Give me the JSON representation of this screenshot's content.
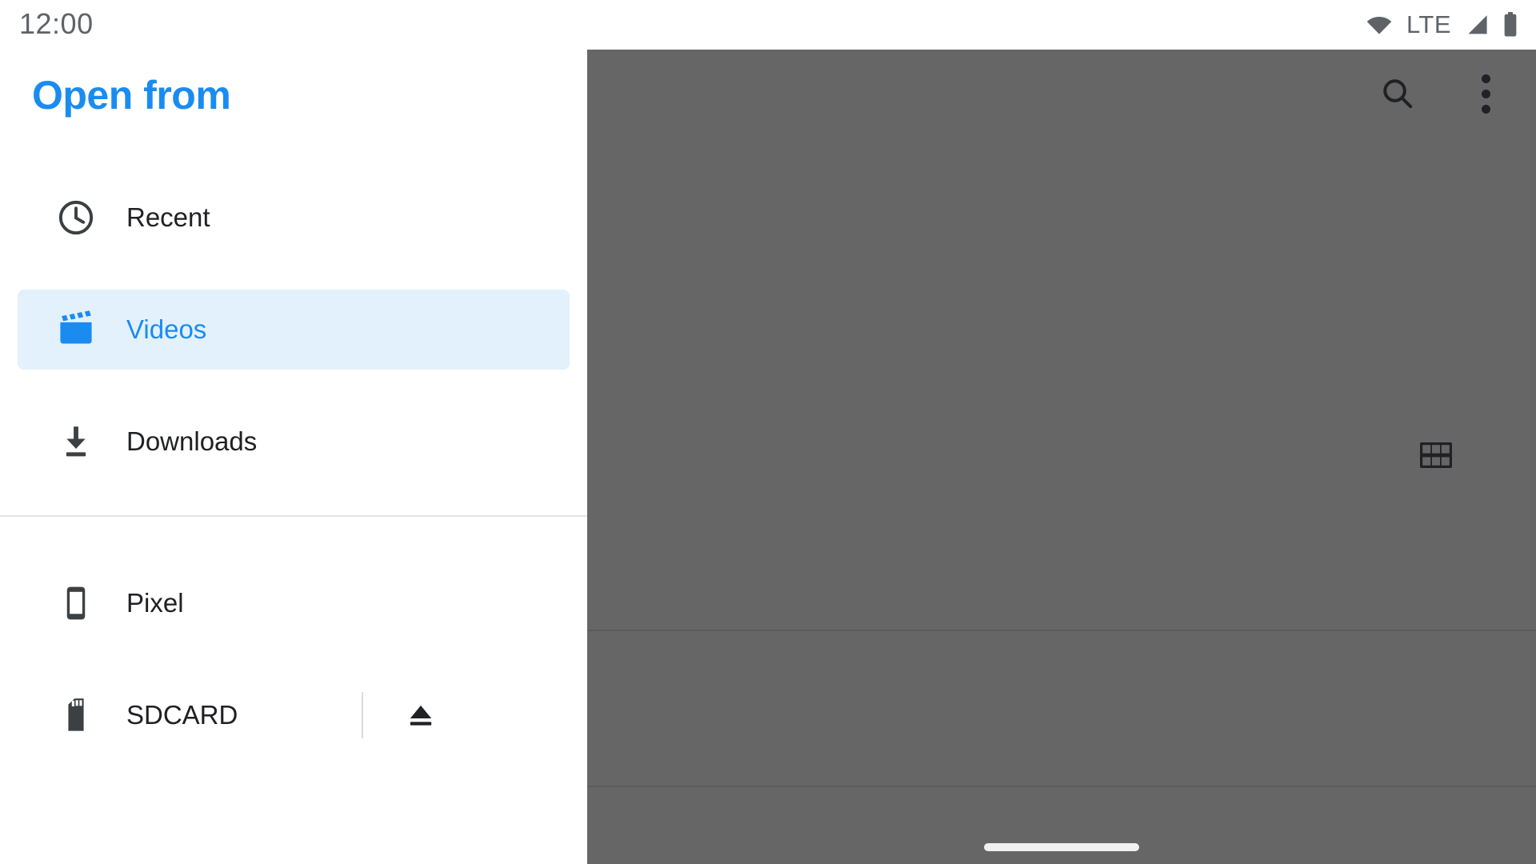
{
  "status_bar": {
    "time": "12:00",
    "network_label": "LTE",
    "icons": [
      "wifi-icon",
      "signal-icon",
      "battery-icon"
    ]
  },
  "drawer": {
    "title": "Open from",
    "selected_item": "Videos",
    "accent_color": "#1a8cf0",
    "selected_background": "#e3f1fd",
    "items": [
      {
        "label": "Recent",
        "icon": "clock-icon",
        "selected": false
      },
      {
        "label": "Videos",
        "icon": "movie-icon",
        "selected": true
      },
      {
        "label": "Downloads",
        "icon": "download-icon",
        "selected": false
      }
    ],
    "devices": [
      {
        "label": "Pixel",
        "icon": "phone-icon",
        "eject": false
      },
      {
        "label": "SDCARD",
        "icon": "sdcard-icon",
        "eject": true,
        "eject_icon": "eject-icon"
      }
    ]
  },
  "content": {
    "scrim_color": "#666666",
    "toolbar": {
      "search_icon": "search-icon",
      "overflow_icon": "more-vert-icon"
    },
    "grid_view_icon": "grid-view-icon",
    "gesture_bar": "home-indicator"
  }
}
